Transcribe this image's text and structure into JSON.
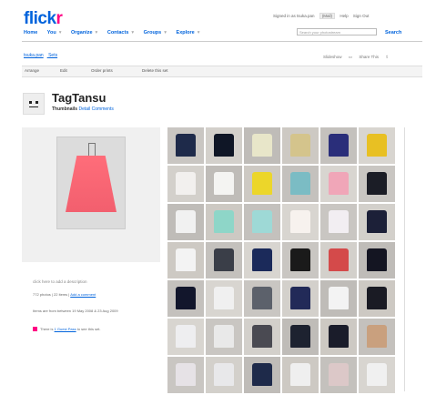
{
  "logo": {
    "part1": "flick",
    "part2": "r"
  },
  "top_links": {
    "signed_in": "Signed in as tsuka.pan",
    "mail": "(Mail)",
    "help": "Help",
    "sign_out": "Sign Out"
  },
  "nav": {
    "items": [
      "Home",
      "You",
      "Organize",
      "Contacts",
      "Groups",
      "Explore"
    ]
  },
  "search": {
    "placeholder": "Search your photostream",
    "button": "Search"
  },
  "breadcrumb": {
    "user": "tsuka.pan",
    "section": "Sets"
  },
  "tools": {
    "slideshow": "Slideshow",
    "share": "Share This"
  },
  "toolbar": {
    "items": [
      "Arrange",
      "Edit",
      "Order prints",
      "Delete this set"
    ]
  },
  "set": {
    "title": "TagTansu",
    "views_current": "Thumbnails",
    "views_other": "Detail",
    "views_comments": "Comments"
  },
  "description_prompt": "click here to add a description",
  "meta": {
    "count_line": "772 photos | 22 items",
    "comment_link": "Add a comment",
    "date_line": "Items are from between 19 May 2008 & 23 Aug 2009"
  },
  "guest": {
    "prefix": "There is",
    "link": "1 Guest Pass",
    "suffix": "to see this set."
  },
  "icons": [
    "buddy-icon",
    "dropdown-arrow-icon",
    "slideshow-icon",
    "share-icon",
    "guest-pass-icon"
  ],
  "colors": {
    "brand_blue": "#0063dc",
    "brand_pink": "#ff0084"
  },
  "thumbnail_garments": [
    [
      "#1e2a4a",
      "#0f1626",
      "#e8e6c9",
      "#d4c48c",
      "#2a2e7a",
      "#e8c023"
    ],
    [
      "#f2f0ee",
      "#f4f4f2",
      "#ecd62a",
      "#7bbcc4",
      "#f0a6b8",
      "#1b1d26"
    ],
    [
      "#f1f1f1",
      "#8ed6c8",
      "#9ed9d6",
      "#f7f2ee",
      "#f2eef2",
      "#1c2038"
    ],
    [
      "#f3f3f3",
      "#3a3e48",
      "#1b2a5a",
      "#1a1a1a",
      "#d44a4a",
      "#141522"
    ],
    [
      "#12162c",
      "#f0f0f0",
      "#5c616b",
      "#222a58",
      "#f3f3f3",
      "#1a1b24"
    ],
    [
      "#eeeef0",
      "#e9e9e9",
      "#4a4a52",
      "#1d2230",
      "#1a1c2a",
      "#c9a07e"
    ],
    [
      "#e6e2e6",
      "#e8e8ea",
      "#1e2a4a",
      "#efefef",
      "#dcc8c8",
      "#f0f0f0"
    ]
  ]
}
